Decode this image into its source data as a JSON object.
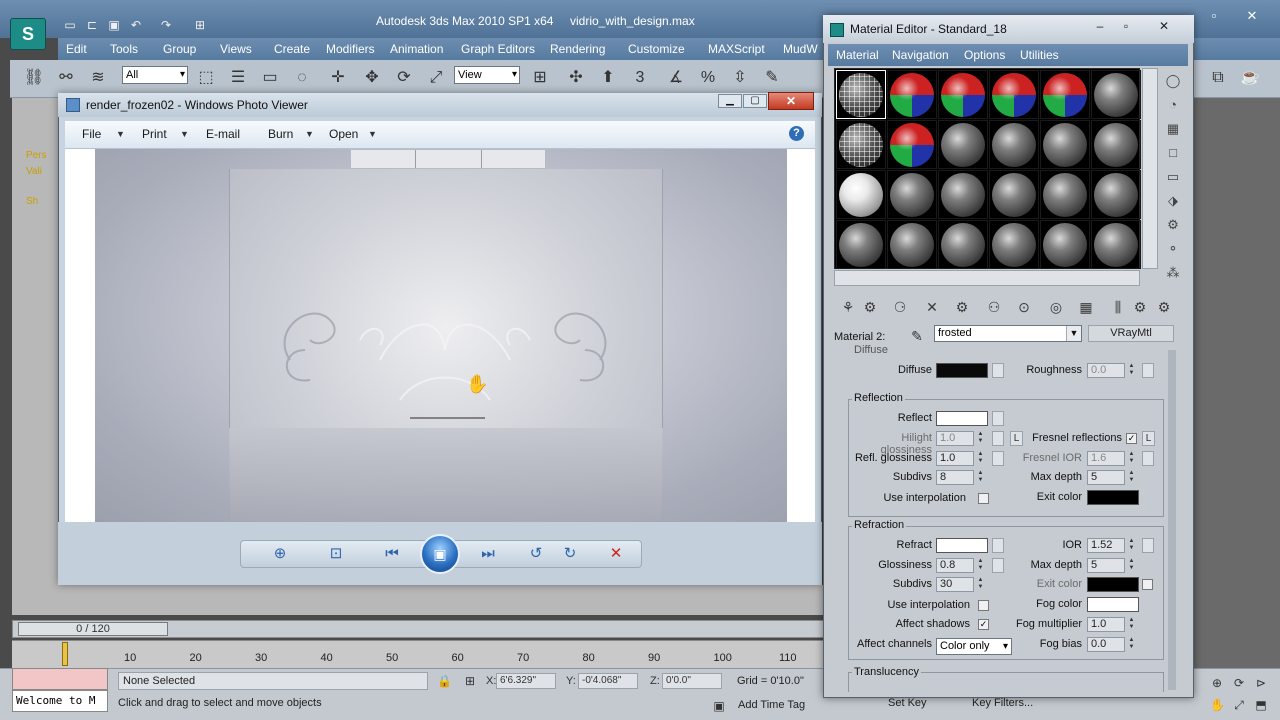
{
  "max": {
    "title": "Autodesk 3ds Max  2010 SP1 x64",
    "file": "vidrio_with_design.max",
    "logo": "S",
    "menu": [
      "Edit",
      "Tools",
      "Group",
      "Views",
      "Create",
      "Modifiers",
      "Animation",
      "Graph Editors",
      "Rendering",
      "Customize",
      "MAXScript",
      "MudW"
    ],
    "toolbar": {
      "selection_filter": "All",
      "ref_coord": "View",
      "snap_label": "3"
    },
    "viewport_labels": [
      "Pers",
      "Vali",
      "Sh"
    ],
    "time_slider": "0 / 120",
    "ticks": [
      "10",
      "20",
      "30",
      "40",
      "50",
      "60",
      "70",
      "80",
      "90",
      "100",
      "110"
    ],
    "status": {
      "listener": "Welcome to M",
      "selected": "None Selected",
      "prompt": "Click and drag to select and move objects",
      "x_label": "X:",
      "x_value": "6'6.329\"",
      "y_label": "Y:",
      "y_value": "-0'4.068\"",
      "z_label": "Z:",
      "z_value": "0'0.0\"",
      "grid": "Grid = 0'10.0\"",
      "add_time_tag": "Add Time Tag",
      "set_key": "Set Key",
      "key_filters": "Key Filters..."
    }
  },
  "photo_viewer": {
    "title": "render_frozen02 - Windows Photo Viewer",
    "menu": {
      "file": "File",
      "print": "Print",
      "email": "E-mail",
      "burn": "Burn",
      "open": "Open"
    },
    "help": "?",
    "controls": {
      "zoom": "⊕",
      "actual_size": "⊡",
      "prev": "⏮",
      "slideshow": "▣",
      "next": "⏭",
      "rotate_ccw": "↺",
      "rotate_cw": "↻",
      "delete": "✕"
    }
  },
  "material_editor": {
    "title": "Material Editor - Standard_18",
    "menu": [
      "Material",
      "Navigation",
      "Options",
      "Utilities"
    ],
    "material_label": "Material 2:",
    "material_name": "frosted",
    "material_type": "VRayMtl",
    "slot_types": [
      "grid",
      "checker",
      "checker",
      "checker",
      "checker",
      "dark",
      "grid",
      "checker",
      "dark",
      "dark",
      "dark",
      "dark",
      "white",
      "dark",
      "dark",
      "dark",
      "dark",
      "dark",
      "dark",
      "dark",
      "dark",
      "dark",
      "dark",
      "dark"
    ],
    "diffuse_header": "Diffuse",
    "diffuse": {
      "label": "Diffuse",
      "color": "#0a0a0a",
      "roughness_label": "Roughness",
      "roughness": "0.0"
    },
    "reflection": {
      "title": "Reflection",
      "reflect_label": "Reflect",
      "reflect_color": "#ffffff",
      "hilight_label": "Hilight glossiness",
      "hilight": "1.0",
      "hilight_lock": "L",
      "fresnel_label": "Fresnel reflections",
      "fresnel_check": "✓",
      "fresnel_lock": "L",
      "refl_gloss_label": "Refl. glossiness",
      "refl_gloss": "1.0",
      "fresnel_ior_label": "Fresnel IOR",
      "fresnel_ior": "1.6",
      "subdivs_label": "Subdivs",
      "subdivs": "8",
      "max_depth_label": "Max depth",
      "max_depth": "5",
      "interp_label": "Use interpolation",
      "exit_label": "Exit color",
      "exit_color": "#000000"
    },
    "refraction": {
      "title": "Refraction",
      "refract_label": "Refract",
      "refract_color": "#ffffff",
      "ior_label": "IOR",
      "ior": "1.52",
      "gloss_label": "Glossiness",
      "gloss": "0.8",
      "max_depth_label": "Max depth",
      "max_depth": "5",
      "subdivs_label": "Subdivs",
      "subdivs": "30",
      "exit_label": "Exit color",
      "exit_color": "#000000",
      "interp_label": "Use interpolation",
      "fog_color_label": "Fog color",
      "fog_color": "#ffffff",
      "shadows_label": "Affect shadows",
      "shadows_check": "✓",
      "fog_mult_label": "Fog multiplier",
      "fog_mult": "1.0",
      "channels_label": "Affect channels",
      "channels_value": "Color only",
      "fog_bias_label": "Fog bias",
      "fog_bias": "0.0"
    },
    "translucency": {
      "title": "Translucency"
    }
  }
}
